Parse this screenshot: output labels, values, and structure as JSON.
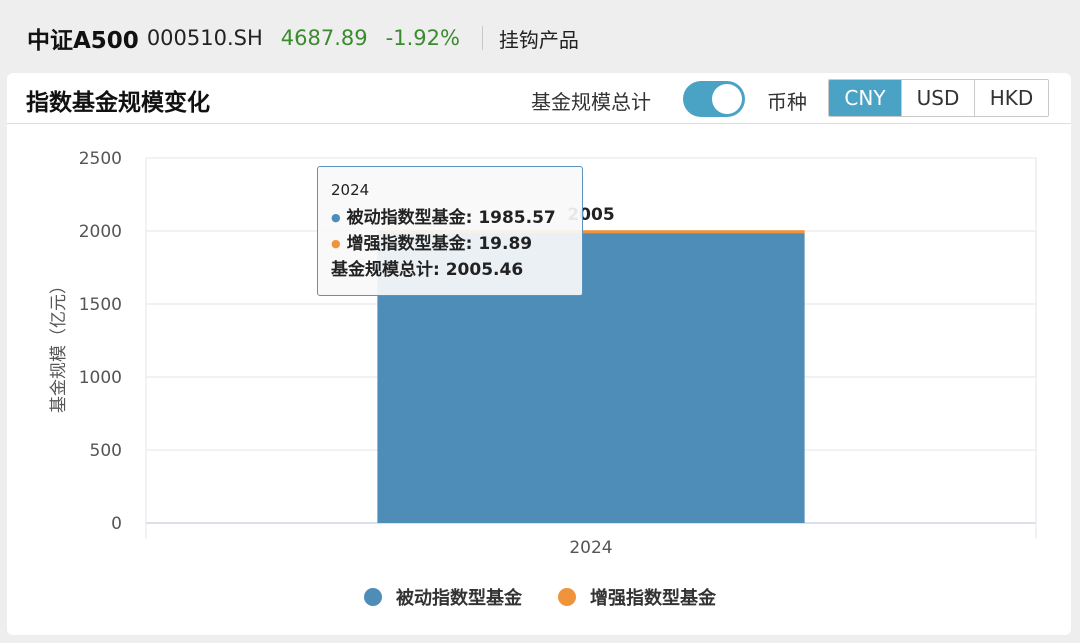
{
  "header": {
    "name": "中证A500",
    "code": "000510.SH",
    "price": "4687.89",
    "change": "-1.92%",
    "link": "挂钩产品",
    "price_color": "#3a8a2e"
  },
  "panel": {
    "title": "指数基金规模变化",
    "total_label": "基金规模总计",
    "total_enabled": true,
    "currency_label": "币种",
    "currencies": [
      "CNY",
      "USD",
      "HKD"
    ],
    "selected_currency": "CNY",
    "accent_color": "#4aa3c4"
  },
  "tooltip": {
    "title": "2024",
    "rows": [
      {
        "text": "被动指数型基金: 1985.57",
        "color": "#4f8db9"
      },
      {
        "text": "增强指数型基金: 19.89",
        "color": "#f0943c"
      }
    ],
    "total": "基金规模总计: 2005.46"
  },
  "chart_data": {
    "type": "bar",
    "stacked": true,
    "categories": [
      "2024"
    ],
    "series": [
      {
        "name": "被动指数型基金",
        "values": [
          1985.57
        ],
        "color": "#4f8db9"
      },
      {
        "name": "增强指数型基金",
        "values": [
          19.89
        ],
        "color": "#f0943c"
      }
    ],
    "total_labels": [
      "2005"
    ],
    "ylabel": "基金规模（亿元）",
    "ylim": [
      0,
      2500
    ],
    "yticks": [
      0,
      500,
      1000,
      1500,
      2000,
      2500
    ],
    "grid": true,
    "legend": "bottom"
  }
}
